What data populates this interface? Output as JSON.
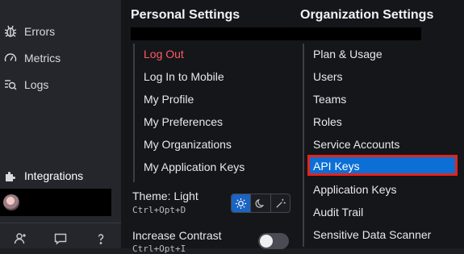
{
  "sidebar": {
    "items": [
      {
        "label": "Errors",
        "icon": "bug-icon"
      },
      {
        "label": "Metrics",
        "icon": "gauge-icon"
      },
      {
        "label": "Logs",
        "icon": "logs-icon"
      },
      {
        "label": "Integrations",
        "icon": "puzzle-icon"
      }
    ],
    "bottom_icons": [
      "add-user-icon",
      "chat-icon",
      "help-icon"
    ]
  },
  "personal": {
    "title": "Personal Settings",
    "items": [
      "Log Out",
      "Log In to Mobile",
      "My Profile",
      "My Preferences",
      "My Organizations",
      "My Application Keys"
    ],
    "theme": {
      "label": "Theme: Light",
      "shortcut": "Ctrl+Opt+D",
      "options": [
        "sun-icon",
        "moon-icon",
        "auto-icon"
      ],
      "selected": "sun-icon"
    },
    "contrast": {
      "label": "Increase Contrast",
      "shortcut": "Ctrl+Opt+I",
      "enabled": false
    }
  },
  "organization": {
    "title": "Organization Settings",
    "items": [
      "Plan & Usage",
      "Users",
      "Teams",
      "Roles",
      "Service Accounts",
      "API Keys",
      "Application Keys",
      "Audit Trail",
      "Sensitive Data Scanner"
    ],
    "selected": "API Keys"
  },
  "colors": {
    "accent": "#0b6fd6",
    "highlight_border": "#e5231b",
    "logout": "#ff5a63"
  }
}
